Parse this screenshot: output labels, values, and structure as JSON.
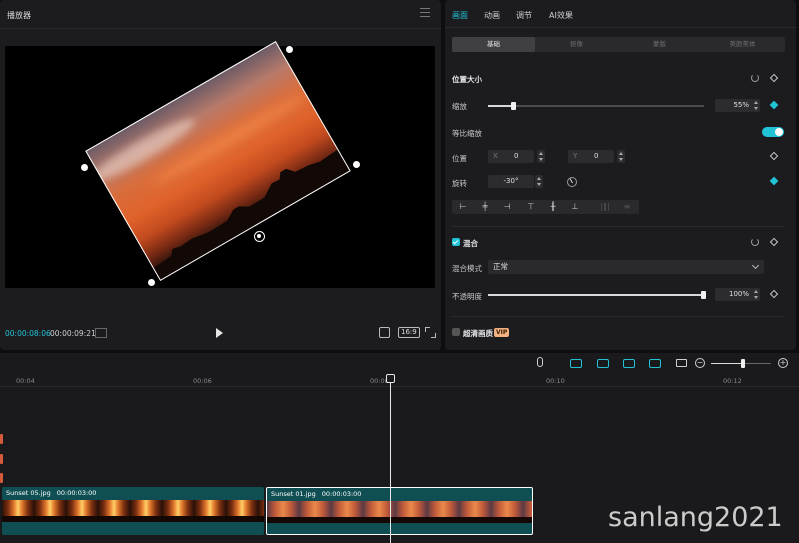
{
  "player": {
    "title": "播放器",
    "timecode_current": "00:00:08:06",
    "timecode_total": "00:00:09:21",
    "ratio_label": "16:9"
  },
  "inspector": {
    "tabs": [
      {
        "label": "画面",
        "active": true
      },
      {
        "label": "动画",
        "active": false
      },
      {
        "label": "调节",
        "active": false
      },
      {
        "label": "AI效果",
        "active": false
      }
    ],
    "subtabs": [
      {
        "label": "基础",
        "active": true
      },
      {
        "label": "抠像",
        "active": false
      },
      {
        "label": "蒙版",
        "active": false
      },
      {
        "label": "美颜美体",
        "active": false
      }
    ],
    "position_size": {
      "title": "位置大小",
      "scale_label": "缩放",
      "scale_value": "55%",
      "scale_fraction": 0.12,
      "uniform_label": "等比缩放",
      "uniform_on": true,
      "position_label": "位置",
      "x_axis": "X",
      "x_value": "0",
      "y_axis": "Y",
      "y_value": "0",
      "rotate_label": "旋转",
      "rotate_value": "-30°"
    },
    "blend": {
      "title": "混合",
      "mode_label": "混合模式",
      "mode_value": "正常",
      "opacity_label": "不透明度",
      "opacity_value": "100%",
      "opacity_fraction": 1.0
    },
    "hd": {
      "title": "超清画质",
      "badge": "VIP"
    }
  },
  "timeline": {
    "ruler_labels": [
      "00:04",
      "00:06",
      "00:08",
      "00:10",
      "00:12"
    ],
    "clips": [
      {
        "name": "Sunset 05.jpg",
        "duration": "00:00:03:00",
        "selected": false
      },
      {
        "name": "Sunset 01.jpg",
        "duration": "00:00:03:00",
        "selected": true
      }
    ]
  },
  "watermark": "sanlang2021",
  "colors": {
    "accent": "#21c3d6",
    "panel": "#1c1c1f",
    "clip": "#0f4f53"
  }
}
